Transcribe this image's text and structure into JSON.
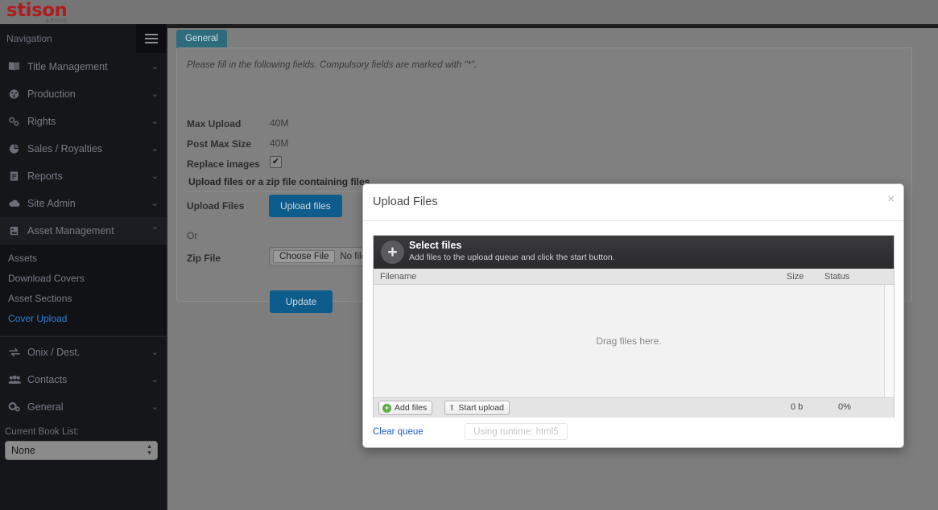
{
  "brand": {
    "name": "stison",
    "sub": "admin"
  },
  "sidebar": {
    "nav_header": "Navigation",
    "menu_icon": "hamburger-icon",
    "items": [
      {
        "label": "Title Management",
        "icon": "book-icon",
        "caret": "⌄",
        "expanded": false
      },
      {
        "label": "Production",
        "icon": "gauge-icon",
        "caret": "⌄",
        "expanded": false
      },
      {
        "label": "Rights",
        "icon": "links-icon",
        "caret": "⌄",
        "expanded": false
      },
      {
        "label": "Sales / Royalties",
        "icon": "pie-chart-icon",
        "caret": "⌄",
        "expanded": false
      },
      {
        "label": "Reports",
        "icon": "document-icon",
        "caret": "⌄",
        "expanded": false
      },
      {
        "label": "Site Admin",
        "icon": "cloud-icon",
        "caret": "⌄",
        "expanded": false
      },
      {
        "label": "Asset Management",
        "icon": "image-icon",
        "caret": "⌃",
        "expanded": true
      }
    ],
    "subitems": [
      {
        "label": "Assets",
        "selected": false
      },
      {
        "label": "Download Covers",
        "selected": false
      },
      {
        "label": "Asset Sections",
        "selected": false
      },
      {
        "label": "Cover Upload",
        "selected": true
      }
    ],
    "items_after": [
      {
        "label": "Onix / Dest.",
        "icon": "transfer-icon",
        "caret": "⌄"
      },
      {
        "label": "Contacts",
        "icon": "people-icon",
        "caret": "⌄"
      },
      {
        "label": "General",
        "icon": "gears-icon",
        "caret": "⌄"
      }
    ],
    "booklist": {
      "label": "Current Book List:",
      "value": "None"
    }
  },
  "main": {
    "tabs": [
      {
        "label": "General",
        "active": true
      }
    ],
    "note": "Please fill in the following fields. Compulsory fields are marked with \"*\".",
    "fields": [
      {
        "label": "Max Upload",
        "value": "40M"
      },
      {
        "label": "Post Max Size",
        "value": "40M"
      }
    ],
    "replace_images": {
      "label": "Replace images",
      "checked": true,
      "check_glyph": "✔"
    },
    "section_heading": "Upload files or a zip file containing files",
    "upload_files": {
      "label": "Upload Files",
      "button": "Upload files"
    },
    "or_label": "Or",
    "zip_file": {
      "label": "Zip File",
      "choose": "Choose File",
      "status": "No file ch"
    },
    "update_button": "Update"
  },
  "modal": {
    "title": "Upload Files",
    "close_glyph": "×",
    "select_files": {
      "title": "Select files",
      "subtitle": "Add files to the upload queue and click the start button.",
      "plus_glyph": "+"
    },
    "columns": {
      "filename": "Filename",
      "size": "Size",
      "status": "Status"
    },
    "dropzone_text": "Drag files here.",
    "footer": {
      "add_files": "Add files",
      "add_files_glyph": "+",
      "start_upload": "Start upload",
      "start_glyph": "⬆",
      "total_size": "0 b",
      "total_pct": "0%"
    },
    "clear_queue": "Clear queue",
    "runtime": "Using runtime: html5"
  },
  "colors": {
    "brand_red": "#b01b1f",
    "sidebar_bg": "#15161a",
    "accent_blue": "#0d5c8c",
    "tab_teal": "#2e6b7d",
    "link_blue": "#2f7fd1",
    "page_bg": "#7d7d7d",
    "green": "#5aab45"
  }
}
